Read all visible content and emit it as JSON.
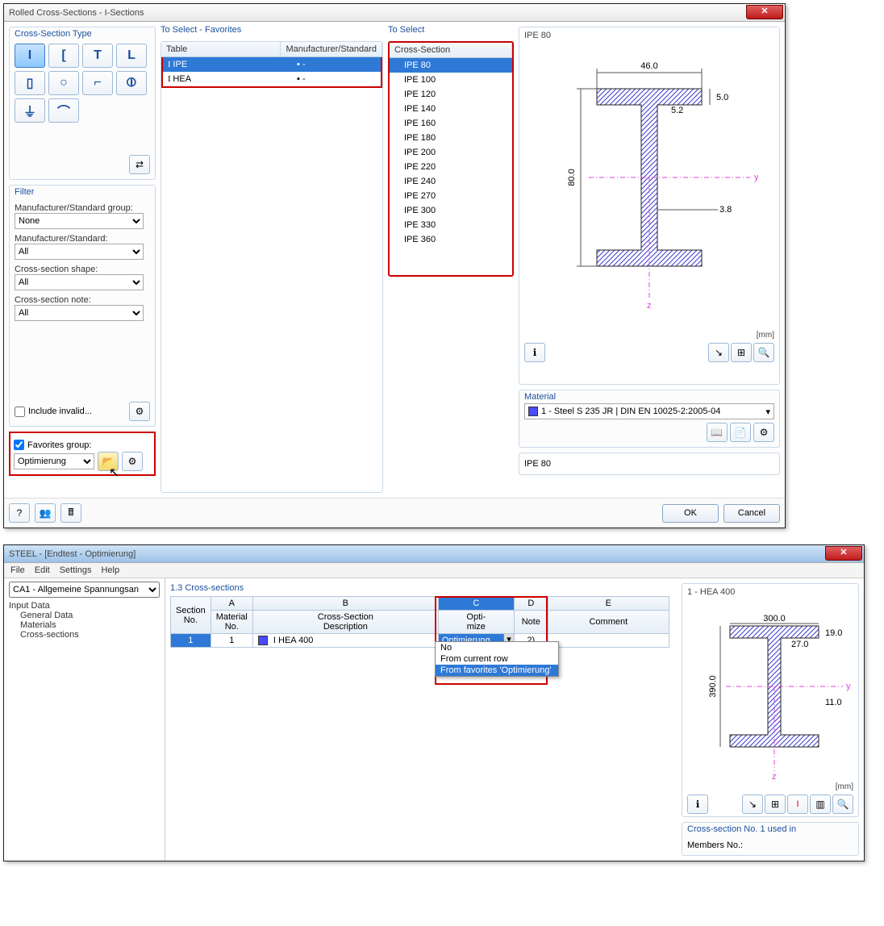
{
  "dialog1": {
    "title": "Rolled Cross-Sections - I-Sections",
    "cstype_title": "Cross-Section Type",
    "shapes": [
      "I",
      "[",
      "T",
      "L",
      "▯",
      "○",
      "◪",
      "⦶",
      "▲",
      "⌒"
    ],
    "filter_title": "Filter",
    "filter_labels": {
      "mfg_group": "Manufacturer/Standard group:",
      "mfg": "Manufacturer/Standard:",
      "shape": "Cross-section shape:",
      "note": "Cross-section note:"
    },
    "filter_values": {
      "mfg_group": "None",
      "mfg": "All",
      "shape": "All",
      "note": "All"
    },
    "include_invalid": "Include invalid...",
    "fav_label": "Favorites group:",
    "fav_value": "Optimierung",
    "favlist_title": "To Select - Favorites",
    "favlist_headers": {
      "table": "Table",
      "mfg": "Manufacturer/Standard"
    },
    "favlist_rows": [
      {
        "table": "IPE",
        "mfg": "-",
        "sel": true
      },
      {
        "table": "HEA",
        "mfg": "-",
        "sel": false
      }
    ],
    "sectlist_title": "To Select",
    "sectlist_header": "Cross-Section",
    "sections": [
      "IPE 80",
      "IPE 100",
      "IPE 120",
      "IPE 140",
      "IPE 160",
      "IPE 180",
      "IPE 200",
      "IPE 220",
      "IPE 240",
      "IPE 270",
      "IPE 300",
      "IPE 330",
      "IPE 360"
    ],
    "preview_label": "IPE 80",
    "dims": {
      "b": "46.0",
      "h": "80.0",
      "tw": "3.8",
      "tf": "5.0",
      "r": "5.2"
    },
    "unit": "[mm]",
    "material_title": "Material",
    "material_value": "1 - Steel S 235 JR | DIN EN 10025-2:2005-04",
    "result_text": "IPE 80",
    "ok": "OK",
    "cancel": "Cancel"
  },
  "dialog2": {
    "title": "STEEL - [Endtest - Optimierung]",
    "menu": [
      "File",
      "Edit",
      "Settings",
      "Help"
    ],
    "case": "CA1 - Allgemeine Spannungsan",
    "tree_root": "Input Data",
    "tree_items": [
      "General Data",
      "Materials",
      "Cross-sections"
    ],
    "sheet_title": "1.3 Cross-sections",
    "cols": {
      "A": "A",
      "B": "B",
      "C": "C",
      "D": "D",
      "E": "E"
    },
    "headers": {
      "sect": "Section\nNo.",
      "mat": "Material\nNo.",
      "desc": "Cross-Section\nDescription",
      "opt": "Opti-\nmize",
      "note": "Note",
      "comment": "Comment"
    },
    "row": {
      "no": "1",
      "mat": "1",
      "desc": "HEA 400",
      "opt": "Optimierung",
      "note": "2)",
      "comment": ""
    },
    "dropdown": [
      "No",
      "From current row",
      "From favorites 'Optimierung'"
    ],
    "preview_label": "1 - HEA 400",
    "dims2": {
      "b": "300.0",
      "h": "390.0",
      "tw": "11.0",
      "tf": "19.0",
      "r": "27.0"
    },
    "unit": "[mm]",
    "usedin": "Cross-section No. 1 used in",
    "members": "Members No.:"
  }
}
